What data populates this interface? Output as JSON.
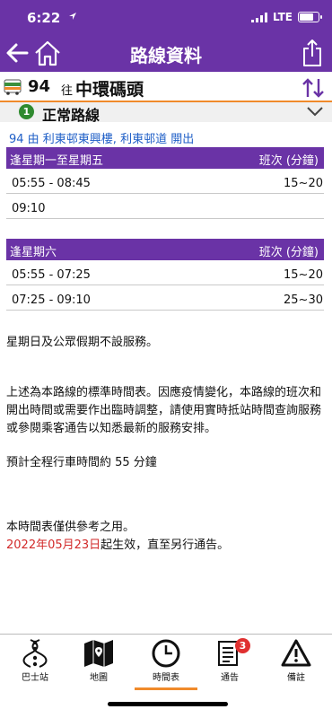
{
  "status_bar": {
    "time": "6:22",
    "network": "LTE"
  },
  "nav": {
    "title": "路線資料"
  },
  "route": {
    "number": "94",
    "to_label": "往",
    "destination": "中環碼頭"
  },
  "route_type": {
    "badge": "1",
    "label": "正常路線"
  },
  "departure_info": "94 由 利東邨東興樓, 利東邨道 開出",
  "schedules": [
    {
      "day_label": "逢星期一至星期五",
      "freq_header": "班次 (分鐘)",
      "rows": [
        {
          "time": "05:55 - 08:45",
          "freq": "15~20"
        },
        {
          "time": "09:10",
          "freq": ""
        }
      ]
    },
    {
      "day_label": "逢星期六",
      "freq_header": "班次 (分鐘)",
      "rows": [
        {
          "time": "05:55 - 07:25",
          "freq": "15~20"
        },
        {
          "time": "07:25 - 09:10",
          "freq": "25~30"
        }
      ]
    }
  ],
  "notes": {
    "holiday": "星期日及公眾假期不設服務。",
    "standard": "上述為本路線的標準時間表。因應疫情變化，本路線的班次和開出時間或需要作出臨時調整，請使用實時抵站時間查詢服務或參閱乘客通告以知悉最新的服務安排。",
    "journey_time": "預計全程行車時間約 55 分鐘",
    "reference": "本時間表僅供參考之用。",
    "effective_date": "2022年05月23日",
    "effective_suffix": "起生效，直至另行通告。"
  },
  "tabs": [
    {
      "label": "巴士站",
      "icon": "bus-stop-icon"
    },
    {
      "label": "地圖",
      "icon": "map-icon"
    },
    {
      "label": "時間表",
      "icon": "clock-icon",
      "active": true
    },
    {
      "label": "通告",
      "icon": "notice-icon",
      "badge": "3"
    },
    {
      "label": "備註",
      "icon": "warning-icon"
    }
  ],
  "colors": {
    "header": "#6a33a6",
    "accent": "#f08a2b",
    "link": "#1f5fc7",
    "alert_red": "#d22a2a"
  }
}
